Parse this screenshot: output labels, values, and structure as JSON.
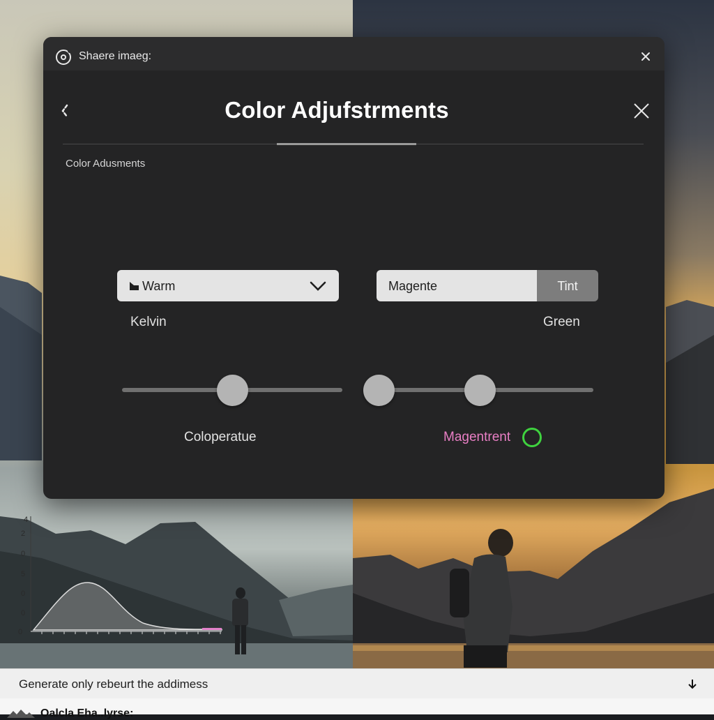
{
  "window": {
    "title": "Shaere imaeg:"
  },
  "dialog": {
    "title": "Color Adjufstrments",
    "section_label": "Color Adusments",
    "warm_select": {
      "selected": "Warm"
    },
    "segmented": {
      "left_label": "Magente",
      "right_label": "Tint"
    },
    "labels": {
      "kelvin": "Kelvin",
      "green": "Green",
      "colorperature": "Coloperatue",
      "magentrent": "Magentrent"
    },
    "sliders": {
      "temperature_value": 0.5,
      "tint_low_value": 0.0,
      "tint_high_value": 0.5
    }
  },
  "histogram": {
    "y_ticks": [
      "4",
      "2",
      "0",
      "5",
      "0",
      "0",
      "0"
    ]
  },
  "bottom_bar": {
    "text": "Generate only rebeurt the addimess"
  },
  "footer": {
    "text": "Oalcla Eha..lyrse:"
  },
  "colors": {
    "dialog_bg": "#242425",
    "accent_magenta": "#e97fc5",
    "status_green": "#3fd23f"
  }
}
